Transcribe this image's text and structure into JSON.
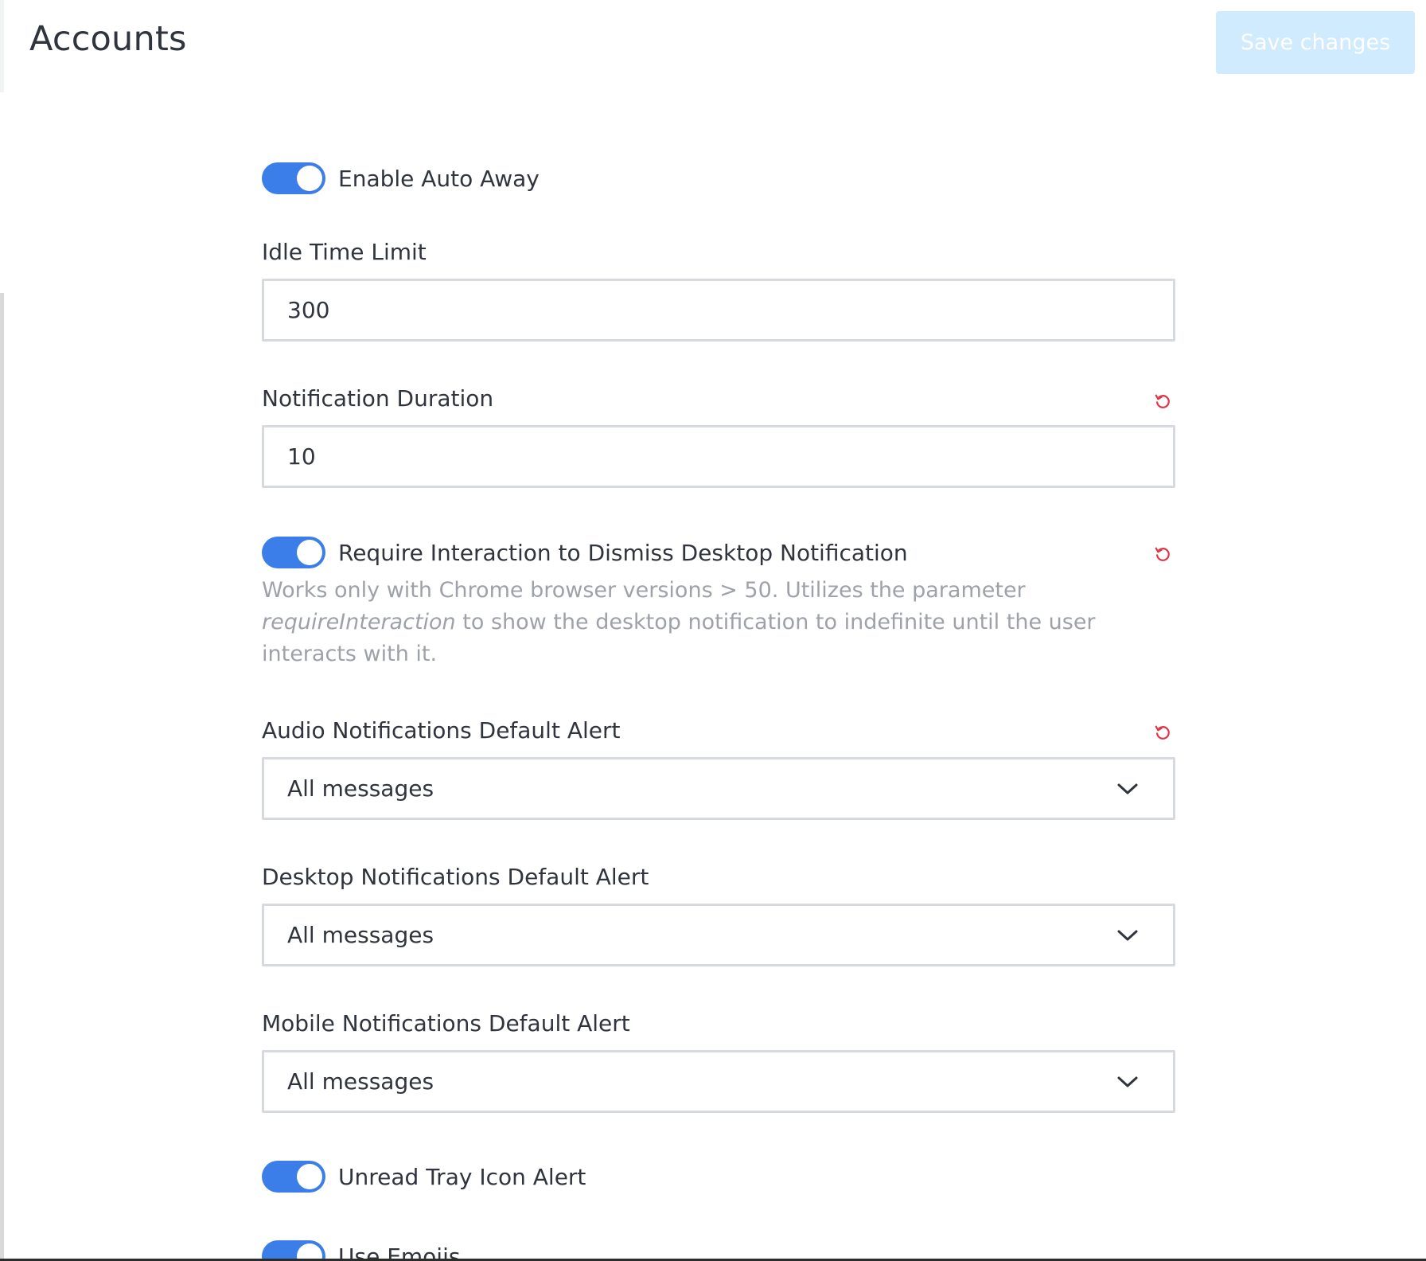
{
  "header": {
    "title": "Accounts",
    "save_label": "Save changes"
  },
  "settings": {
    "enable_auto_away": {
      "label": "Enable Auto Away",
      "enabled": true
    },
    "idle_time_limit": {
      "label": "Idle Time Limit",
      "value": "300"
    },
    "notification_duration": {
      "label": "Notification Duration",
      "value": "10"
    },
    "require_interaction": {
      "label": "Require Interaction to Dismiss Desktop Notification",
      "enabled": true,
      "hint_before": "Works only with Chrome browser versions > 50. Utilizes the parameter ",
      "hint_param": "requireInteraction",
      "hint_after": " to show the desktop notification to indefinite until the user interacts with it."
    },
    "audio_notifications": {
      "label": "Audio Notifications Default Alert",
      "value": "All messages"
    },
    "desktop_notifications": {
      "label": "Desktop Notifications Default Alert",
      "value": "All messages"
    },
    "mobile_notifications": {
      "label": "Mobile Notifications Default Alert",
      "value": "All messages"
    },
    "unread_tray_icon_alert": {
      "label": "Unread Tray Icon Alert",
      "enabled": true
    },
    "use_emojis": {
      "label": "Use Emojis",
      "enabled": true
    }
  },
  "icons": {
    "reset": "reset-icon",
    "dropdown": "chevron-down-icon"
  },
  "colors": {
    "accent": "#3b7ee9",
    "save_button_bg": "#d1ebfe",
    "reset_icon": "#e0364a",
    "hint_text": "#9ea2a8",
    "input_border": "#d6d9de"
  }
}
